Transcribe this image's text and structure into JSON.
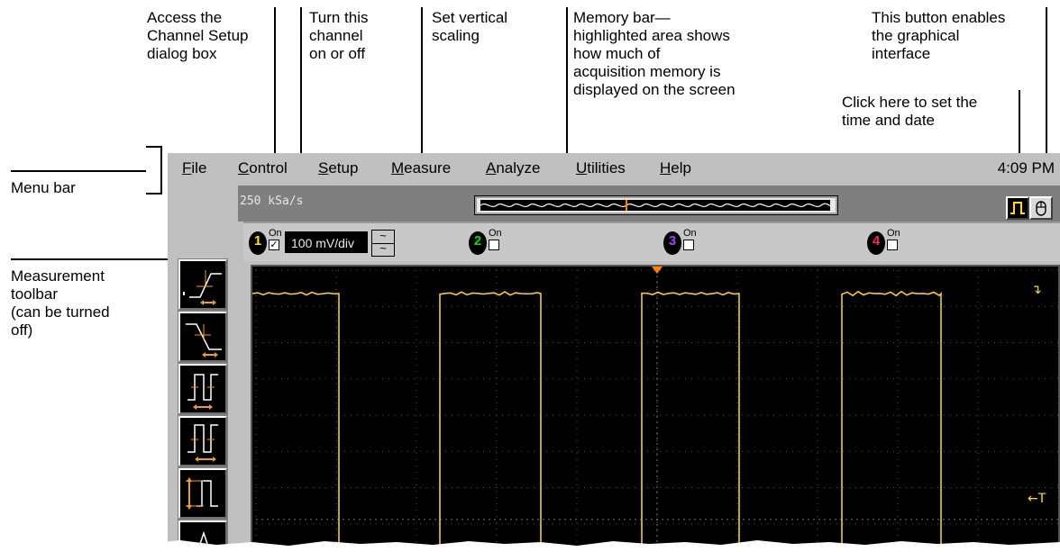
{
  "annotations": {
    "channel_setup": "Access the\nChannel Setup\ndialog box",
    "channel_toggle": "Turn this\nchannel\non or off",
    "vertical_scaling": "Set vertical\nscaling",
    "memory_bar": "Memory bar—\nhighlighted area shows\nhow much of\nacquisition memory is\ndisplayed on the screen",
    "graphical_button": "This button enables\nthe graphical\ninterface",
    "time_date": "Click here to set the\ntime and date",
    "menu_bar": "Menu bar",
    "measurement_toolbar": "Measurement\ntoolbar\n(can be turned\noff)"
  },
  "menubar": {
    "items": [
      {
        "acc": "F",
        "rest": "ile"
      },
      {
        "acc": "C",
        "rest": "ontrol"
      },
      {
        "acc": "S",
        "rest": "etup"
      },
      {
        "acc": "M",
        "rest": "easure"
      },
      {
        "acc": "A",
        "rest": "nalyze"
      },
      {
        "acc": "U",
        "rest": "tilities"
      },
      {
        "acc": "H",
        "rest": "elp"
      }
    ],
    "clock": "4:09 PM"
  },
  "acquisition": {
    "sample_rate": "250 kSa/s"
  },
  "channels": [
    {
      "number": "1",
      "on_label": "On",
      "checked": true,
      "check_mark": "✓",
      "color": "#ffe000",
      "scale": "100 mV/div"
    },
    {
      "number": "2",
      "on_label": "On",
      "checked": false,
      "check_mark": "",
      "color": "#00e000"
    },
    {
      "number": "3",
      "on_label": "On",
      "checked": false,
      "check_mark": "",
      "color": "#a040ff"
    },
    {
      "number": "4",
      "on_label": "On",
      "checked": false,
      "check_mark": "",
      "color": "#ff2060"
    }
  ],
  "scale_spinner": {
    "up": "~",
    "down": "~"
  },
  "markers": {
    "trigger_level": "↴",
    "trigger_ref": "←T"
  },
  "colors": {
    "trace": "#ffe000",
    "screen": "#000000",
    "panel": "#c0c0c0"
  }
}
